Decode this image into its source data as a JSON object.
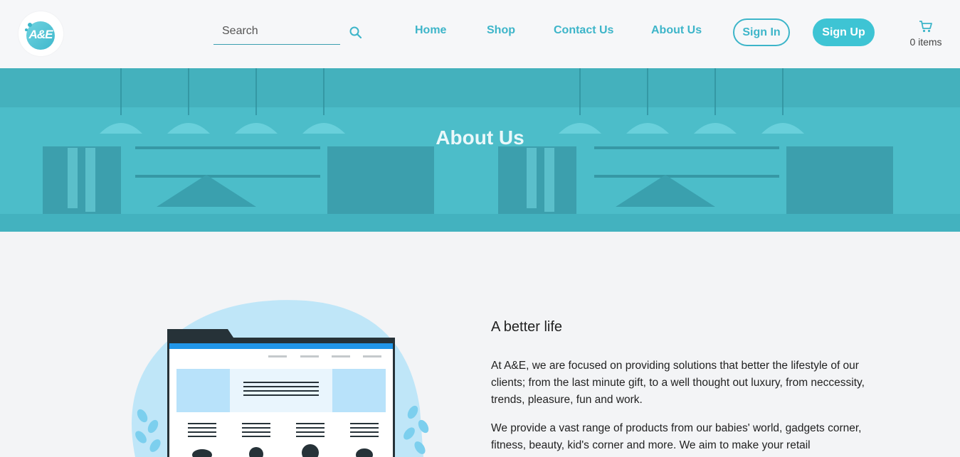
{
  "header": {
    "logo_text": "A&E",
    "search": {
      "placeholder": "Search",
      "value": ""
    },
    "nav": [
      {
        "label": "Home"
      },
      {
        "label": "Shop"
      },
      {
        "label": "Contact Us"
      },
      {
        "label": "About Us"
      }
    ],
    "signin_label": "Sign In",
    "signup_label": "Sign Up",
    "cart": {
      "icon": "cart-icon",
      "count_label": "0 items"
    }
  },
  "hero": {
    "title": "About Us"
  },
  "about": {
    "heading": "A better life",
    "paragraphs": [
      "At A&E, we are focused on providing solutions that better the lifestyle of our clients; from the last minute gift, to a well thought out luxury, from neccessity, trends, pleasure, fun and work.",
      "We provide a vast range of products from our babies' world, gadgets corner, fitness, beauty, kid's corner and more. We aim to make your retail"
    ]
  },
  "colors": {
    "accent": "#3db5c9",
    "hero_overlay": "#4cbdc9",
    "button_fill": "#3ec4d4"
  }
}
